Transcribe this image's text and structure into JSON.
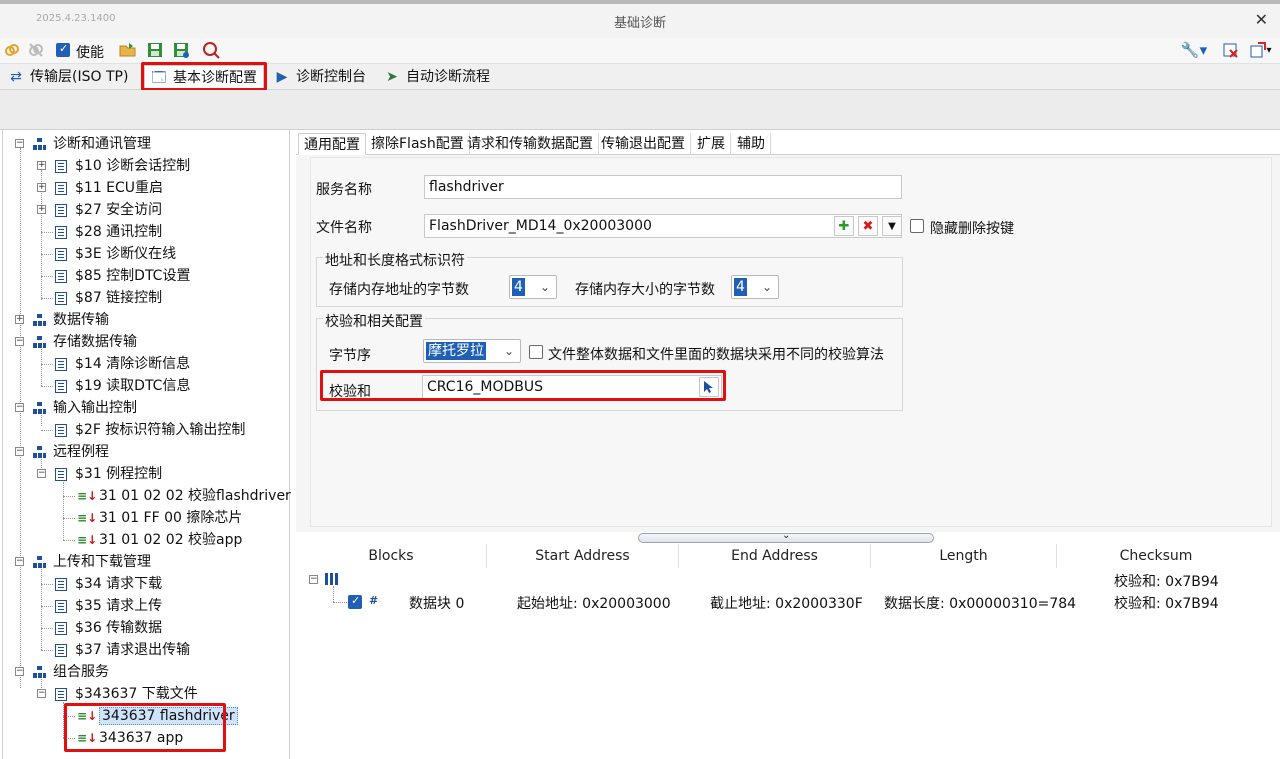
{
  "window": {
    "version": "2025.4.23.1400",
    "title": "基础诊断",
    "close_glyph": "✕"
  },
  "toolbar": {
    "enable_label": "使能",
    "enable_checked": true,
    "icons": [
      "link-icon",
      "unlink-icon",
      "folder-open-icon",
      "save-icon",
      "save-as-icon",
      "search-icon",
      "wrench-icon",
      "delete-icon",
      "export-icon"
    ]
  },
  "main_tabs": [
    {
      "label": "传输层(ISO TP)",
      "icon": "swap-icon"
    },
    {
      "label": "基本诊断配置",
      "icon": "window-icon"
    },
    {
      "label": "诊断控制台",
      "icon": "console-icon"
    },
    {
      "label": "自动诊断流程",
      "icon": "flow-icon"
    }
  ],
  "tree": {
    "nodes": [
      {
        "label": "诊断和通讯管理",
        "type": "group",
        "expander": "−"
      },
      {
        "label": "$10 诊断会话控制",
        "type": "page",
        "expander": "+"
      },
      {
        "label": "$11 ECU重启",
        "type": "page",
        "expander": "+"
      },
      {
        "label": "$27 安全访问",
        "type": "page",
        "expander": "+"
      },
      {
        "label": "$28 通讯控制",
        "type": "page"
      },
      {
        "label": "$3E 诊断仪在线",
        "type": "page"
      },
      {
        "label": "$85 控制DTC设置",
        "type": "page"
      },
      {
        "label": "$87 链接控制",
        "type": "page"
      },
      {
        "label": "数据传输",
        "type": "group",
        "expander": "+"
      },
      {
        "label": "存储数据传输",
        "type": "group",
        "expander": "−"
      },
      {
        "label": "$14 清除诊断信息",
        "type": "page"
      },
      {
        "label": "$19 读取DTC信息",
        "type": "page"
      },
      {
        "label": "输入输出控制",
        "type": "group",
        "expander": "−"
      },
      {
        "label": "$2F 按标识符输入输出控制",
        "type": "page"
      },
      {
        "label": "远程例程",
        "type": "group",
        "expander": "−"
      },
      {
        "label": "$31 例程控制",
        "type": "page",
        "expander": "−"
      },
      {
        "label": "31 01 02 02 校验flashdriver",
        "type": "seq"
      },
      {
        "label": "31 01 FF 00 擦除芯片",
        "type": "seq"
      },
      {
        "label": "31 01 02 02 校验app",
        "type": "seq"
      },
      {
        "label": "上传和下载管理",
        "type": "group",
        "expander": "−"
      },
      {
        "label": "$34 请求下载",
        "type": "page"
      },
      {
        "label": "$35 请求上传",
        "type": "page"
      },
      {
        "label": "$36 传输数据",
        "type": "page"
      },
      {
        "label": "$37 请求退出传输",
        "type": "page"
      },
      {
        "label": "组合服务",
        "type": "group",
        "expander": "−"
      },
      {
        "label": "$343637 下载文件",
        "type": "page",
        "expander": "−"
      },
      {
        "label": "343637 flashdriver",
        "type": "seq",
        "selected": true
      },
      {
        "label": "343637 app",
        "type": "seq"
      }
    ]
  },
  "sub_tabs": [
    "通用配置",
    "擦除Flash配置",
    "请求和传输数据配置",
    "传输退出配置",
    "扩展",
    "辅助"
  ],
  "config": {
    "service_name_label": "服务名称",
    "service_name_value": "flashdriver",
    "file_name_label": "文件名称",
    "file_name_value": "FlashDriver_MD14_0x20003000",
    "hide_delete_label": "隐藏删除按键",
    "add_glyph": "✚",
    "remove_glyph": "✖",
    "dropdown_glyph": "▼",
    "addr_group_title": "地址和长度格式标识符",
    "addr_bytes_label": "存储内存地址的字节数",
    "addr_bytes_value": "4",
    "size_bytes_label": "存储内存大小的字节数",
    "size_bytes_value": "4",
    "checksum_group_title": "校验和相关配置",
    "byte_order_label": "字节序",
    "byte_order_value": "摩托罗拉",
    "diff_algo_label": "文件整体数据和文件里面的数据块采用不同的校验算法",
    "checksum_label": "校验和",
    "checksum_value": "CRC16_MODBUS",
    "combo_arrow": "⌄"
  },
  "splitter_glyph": "⌄",
  "blocks_table": {
    "headers": [
      "Blocks",
      "Start Address",
      "End Address",
      "Length",
      "Checksum"
    ],
    "root_checksum": "校验和: 0x7B94",
    "rows": [
      {
        "block": "数据块 0",
        "start": "起始地址: 0x20003000",
        "end": "截止地址: 0x2000330F",
        "length": "数据长度: 0x00000310=784",
        "checksum": "校验和: 0x7B94",
        "checked": true,
        "hash": "#"
      }
    ]
  },
  "colors": {
    "highlight": "#e01010",
    "accent": "#1f5fb5"
  }
}
